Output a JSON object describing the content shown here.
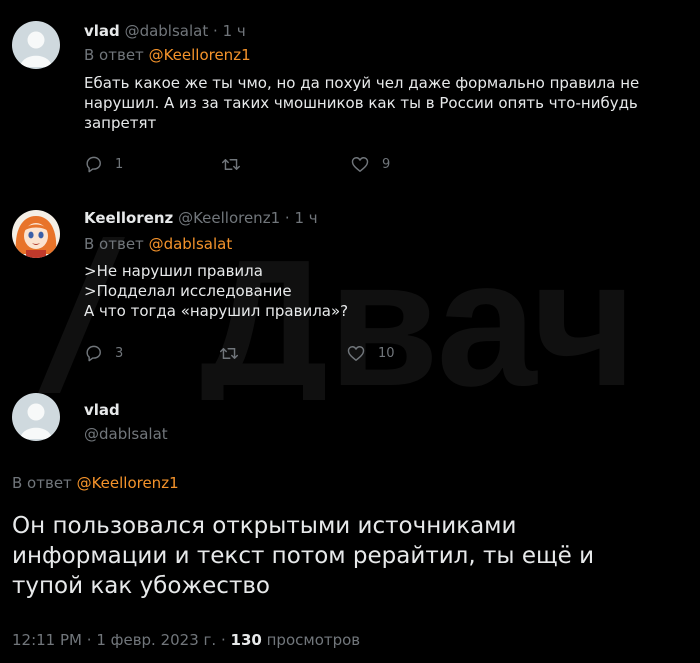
{
  "colors": {
    "background": "#000000",
    "text": "#e7e9ea",
    "muted": "#71767b",
    "mention": "#f4932b"
  },
  "watermark": {
    "text": "Двач",
    "logo_icon": "slash-logo-icon"
  },
  "tweets": [
    {
      "name": "vlad",
      "handle": "@dablsalat",
      "dot": "·",
      "time": "1 ч",
      "reply_prefix": "В ответ",
      "reply_to": "@Keellorenz1",
      "lines": [
        "Ебать какое же ты чмо, но да похуй чел даже формально правила не",
        "нарушил. А из за таких чмошников как ты в России опять что-нибудь",
        "запретят"
      ],
      "replies": "1",
      "retweets": "",
      "likes": "9",
      "avatar_icon": "default-avatar-icon"
    },
    {
      "name": "Keellorenz",
      "handle": "@Keellorenz1",
      "dot": "·",
      "time": "1 ч",
      "reply_prefix": "В ответ",
      "reply_to": "@dablsalat",
      "lines": [
        ">Не нарушил правила",
        ">Подделал исследование",
        "А что тогда «нарушил правила»?"
      ],
      "replies": "3",
      "retweets": "",
      "likes": "10",
      "avatar_icon": "anime-girl-avatar-icon"
    }
  ],
  "main_tweet": {
    "name": "vlad",
    "handle": "@dablsalat",
    "reply_prefix": "В ответ",
    "reply_to": "@Keellorenz1",
    "lines": [
      "Он пользовался открытыми источниками",
      "информации и текст потом рерайтил, ты ещё и",
      "тупой как убожество"
    ],
    "time": "12:11 PM",
    "separator": "·",
    "date": "1 февр. 2023 г.",
    "views_count": "130",
    "views_label": "просмотров"
  }
}
